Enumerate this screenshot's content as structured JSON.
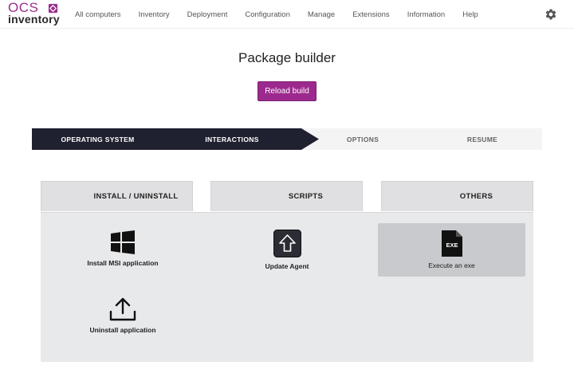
{
  "logo": {
    "top": "OCS",
    "bottom": "inventory"
  },
  "nav": {
    "items": [
      "All computers",
      "Inventory",
      "Deployment",
      "Configuration",
      "Manage",
      "Extensions",
      "Information",
      "Help"
    ],
    "settings_icon": "gear-icon"
  },
  "page": {
    "title": "Package builder",
    "reload_label": "Reload build"
  },
  "stepper": {
    "steps": [
      {
        "label": "OPERATING SYSTEM",
        "active": true
      },
      {
        "label": "INTERACTIONS",
        "active": true
      },
      {
        "label": "OPTIONS",
        "active": false
      },
      {
        "label": "RESUME",
        "active": false
      }
    ]
  },
  "tabs": [
    "INSTALL / UNINSTALL",
    "SCRIPTS",
    "OTHERS"
  ],
  "actions": {
    "install_msi": {
      "label": "Install MSI application",
      "icon": "windows-icon"
    },
    "update_agent": {
      "label": "Update Agent",
      "icon": "upload-arrow-icon"
    },
    "execute_exe": {
      "label": "Execute an exe",
      "icon": "exe-file-icon",
      "badge": "EXE",
      "selected": true
    },
    "uninstall": {
      "label": "Uninstall application",
      "icon": "upload-tray-icon"
    }
  },
  "colors": {
    "accent": "#9c2a8e",
    "stepper_active": "#1f2130",
    "panel_bg": "#e8e9eb"
  }
}
